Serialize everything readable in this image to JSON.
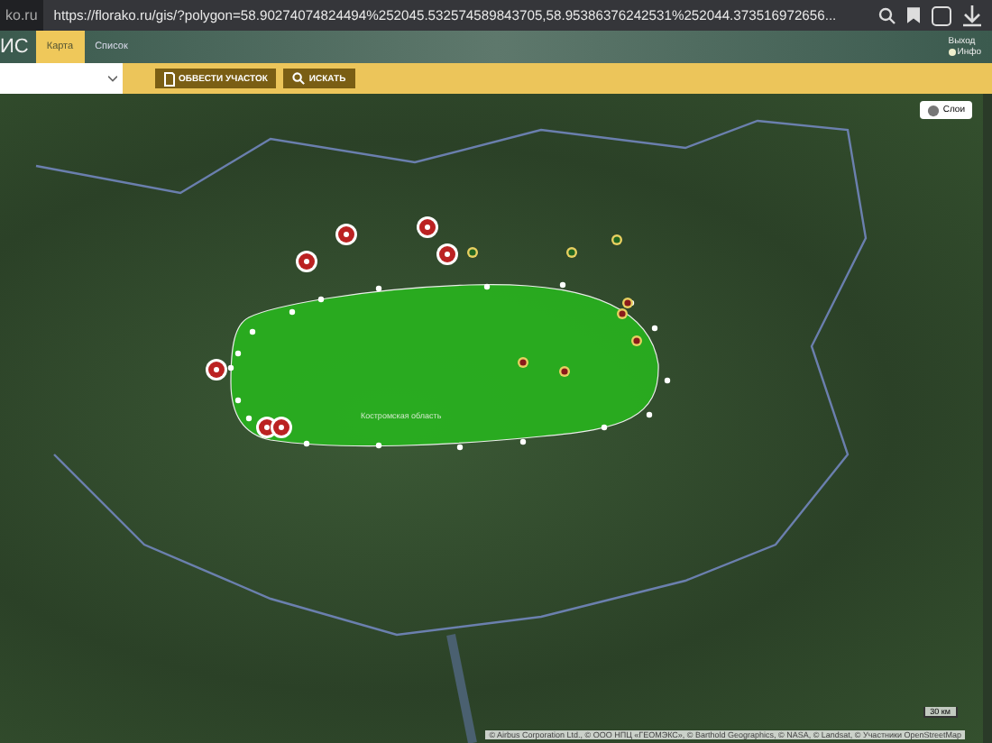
{
  "browser": {
    "url_prefix": "ko.ru",
    "url": "https://florako.ru/gis/?polygon=58.90274074824494%252045.532574589843705,58.95386376242531%252044.373516972656..."
  },
  "app": {
    "logo": "ИС",
    "tabs": [
      {
        "label": "Карта",
        "selected": true
      },
      {
        "label": "Список",
        "selected": false
      }
    ],
    "links": [
      {
        "label": "Выход",
        "kind": "plain"
      },
      {
        "label": "Инфо",
        "kind": "info"
      }
    ]
  },
  "toolbar": {
    "buttons": [
      {
        "label": "ОБВЕСТИ УЧАСТОК",
        "kind": "draw"
      },
      {
        "label": "ИСКАТЬ",
        "kind": "search"
      }
    ]
  },
  "map": {
    "layers_button": "Слои",
    "region_label": "Костромская область",
    "scale": "30 км",
    "attribution": "© Airbus Corporation Ltd., © ООО НПЦ «ГЕОМЭКС», © Barthold Geographics, © NASA, © Landsat, © Участники OpenStreetMap"
  }
}
